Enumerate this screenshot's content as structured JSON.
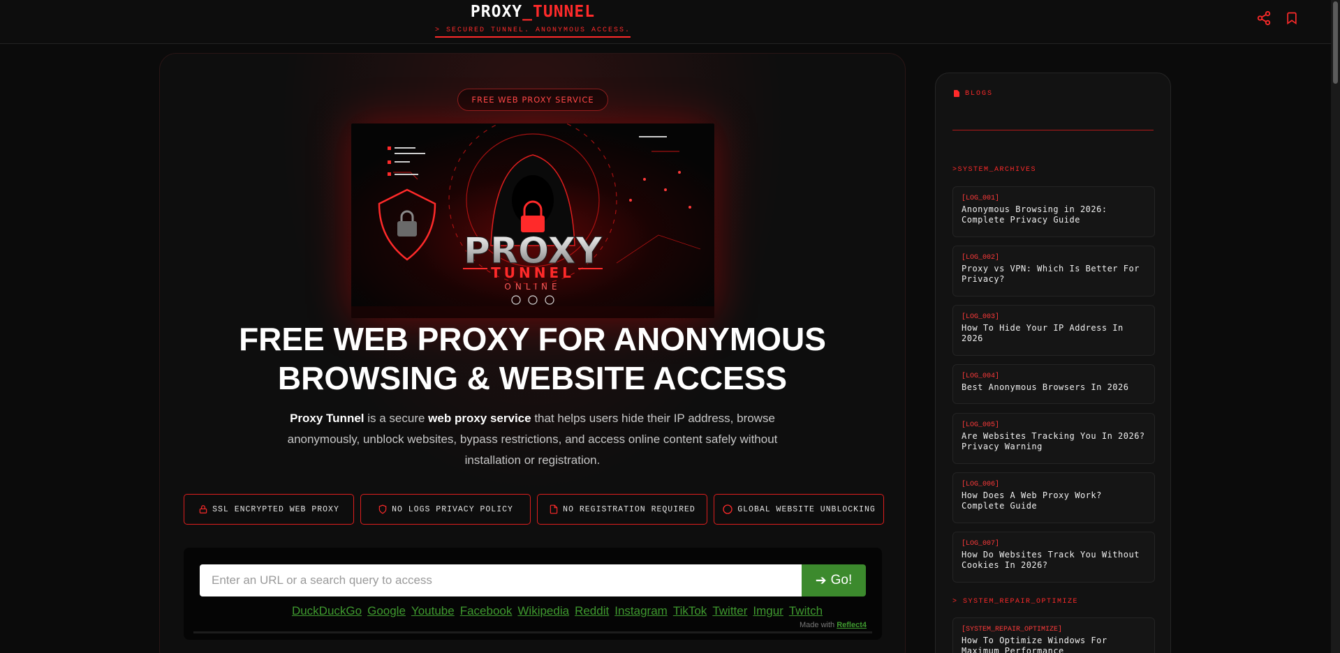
{
  "header": {
    "brand_main": "PROXY",
    "brand_accent": "_TUNNEL",
    "tagline": "> SECURED TUNNEL. ANONYMOUS ACCESS.",
    "icons": [
      "share-icon",
      "bookmark-icon"
    ]
  },
  "hero": {
    "badge": "FREE WEB PROXY SERVICE",
    "image_text": {
      "line1": "PROXY",
      "line2": "TUNNEL",
      "line3": "ONLINE"
    },
    "headline": "FREE WEB PROXY FOR ANONYMOUS BROWSING & WEBSITE ACCESS",
    "desc_brand": "Proxy Tunnel",
    "desc_part1": " is a secure ",
    "desc_strong": "web proxy service",
    "desc_part2": " that helps users hide their IP address, browse anonymously, unblock websites, bypass restrictions, and access online content safely without installation or registration."
  },
  "features": [
    {
      "label": "SSL ENCRYPTED WEB PROXY",
      "icon": "lock-icon"
    },
    {
      "label": "NO LOGS PRIVACY POLICY",
      "icon": "shield-icon"
    },
    {
      "label": "NO REGISTRATION REQUIRED",
      "icon": "document-icon"
    },
    {
      "label": "GLOBAL WEBSITE UNBLOCKING",
      "icon": "globe-icon"
    }
  ],
  "search": {
    "placeholder": "Enter an URL or a search query to access",
    "go_label": "Go!",
    "quick_links": [
      "DuckDuckGo",
      "Google",
      "Youtube",
      "Facebook",
      "Wikipedia",
      "Reddit",
      "Instagram",
      "TikTok",
      "Twitter",
      "Imgur",
      "Twitch"
    ],
    "made_with_prefix": "Made with ",
    "made_with_link": "Reflect4"
  },
  "sidebar": {
    "heading": "BLOGS",
    "section1": ">SYSTEM_ARCHIVES",
    "logs": [
      {
        "id": "[LOG_001]",
        "title": "Anonymous Browsing in 2026: Complete Privacy Guide"
      },
      {
        "id": "[LOG_002]",
        "title": "Proxy vs VPN: Which Is Better For Privacy?"
      },
      {
        "id": "[LOG_003]",
        "title": "How To Hide Your IP Address In 2026"
      },
      {
        "id": "[LOG_004]",
        "title": "Best Anonymous Browsers In 2026"
      },
      {
        "id": "[LOG_005]",
        "title": "Are Websites Tracking You In 2026? Privacy Warning"
      },
      {
        "id": "[LOG_006]",
        "title": "How Does A Web Proxy Work? Complete Guide"
      },
      {
        "id": "[LOG_007]",
        "title": "How Do Websites Track You Without Cookies In 2026?"
      }
    ],
    "section2": "> SYSTEM_REPAIR_OPTIMIZE",
    "repair_log": {
      "id": "[SYSTEM_REPAIR_OPTIMIZE]",
      "title": "How To Optimize Windows For Maximum Performance"
    }
  },
  "colors": {
    "accent": "#ff2a2a",
    "go_button": "#3c8a2d",
    "link": "#3f9a2f"
  }
}
